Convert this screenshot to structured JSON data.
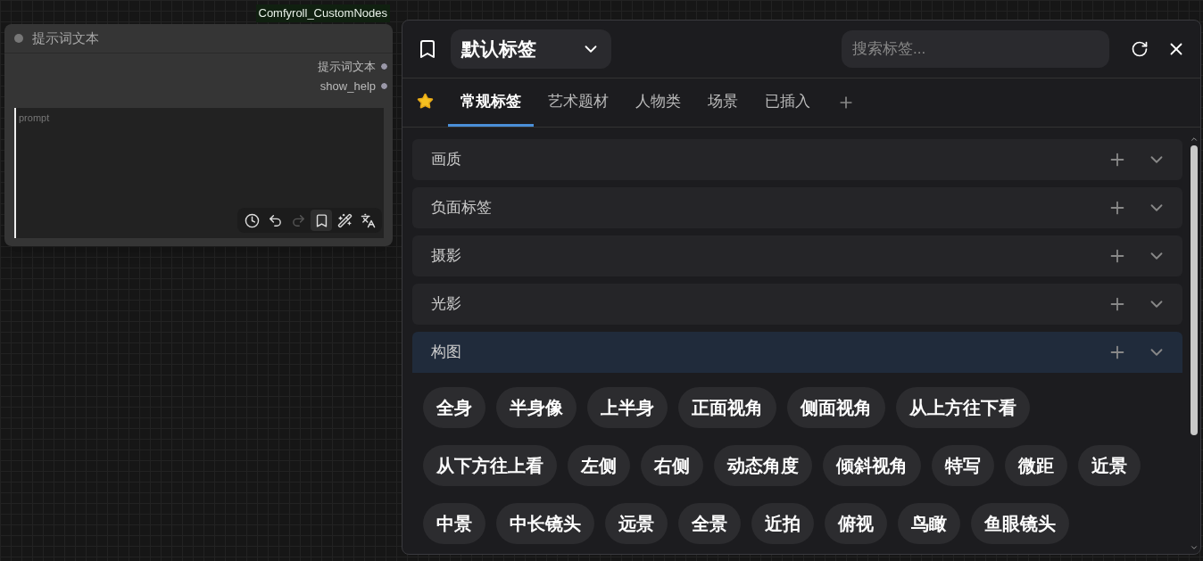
{
  "node": {
    "badge": "Comfyroll_CustomNodes",
    "title": "提示词文本",
    "outputs": [
      "提示词文本",
      "show_help"
    ],
    "prompt": {
      "placeholder": "prompt"
    },
    "toolbar": [
      {
        "kind": "history",
        "active": false,
        "disabled": false
      },
      {
        "kind": "undo",
        "active": false,
        "disabled": false
      },
      {
        "kind": "redo",
        "active": false,
        "disabled": true
      },
      {
        "kind": "bookmark",
        "active": true,
        "disabled": false
      },
      {
        "kind": "wand",
        "active": false,
        "disabled": false
      },
      {
        "kind": "translate",
        "active": false,
        "disabled": false
      }
    ]
  },
  "panel": {
    "library": "默认标签",
    "search": {
      "placeholder": "搜索标签..."
    },
    "tabs": [
      {
        "kind": "favorites",
        "selected": false
      },
      {
        "kind": "text",
        "label": "常规标签",
        "selected": true
      },
      {
        "kind": "text",
        "label": "艺术题材",
        "selected": false
      },
      {
        "kind": "text",
        "label": "人物类",
        "selected": false
      },
      {
        "kind": "text",
        "label": "场景",
        "selected": false
      },
      {
        "kind": "text",
        "label": "已插入",
        "selected": false
      }
    ],
    "sections": [
      {
        "title": "画质",
        "expanded": false
      },
      {
        "title": "负面标签",
        "expanded": false
      },
      {
        "title": "摄影",
        "expanded": false
      },
      {
        "title": "光影",
        "expanded": false
      },
      {
        "title": "构图",
        "expanded": true,
        "tags": [
          "全身",
          "半身像",
          "上半身",
          "正面视角",
          "侧面视角",
          "从上方往下看",
          "从下方往上看",
          "左侧",
          "右侧",
          "动态角度",
          "倾斜视角",
          "特写",
          "微距",
          "近景",
          "中景",
          "中长镜头",
          "远景",
          "全景",
          "近拍",
          "俯视",
          "鸟瞰",
          "鱼眼镜头"
        ]
      }
    ]
  }
}
